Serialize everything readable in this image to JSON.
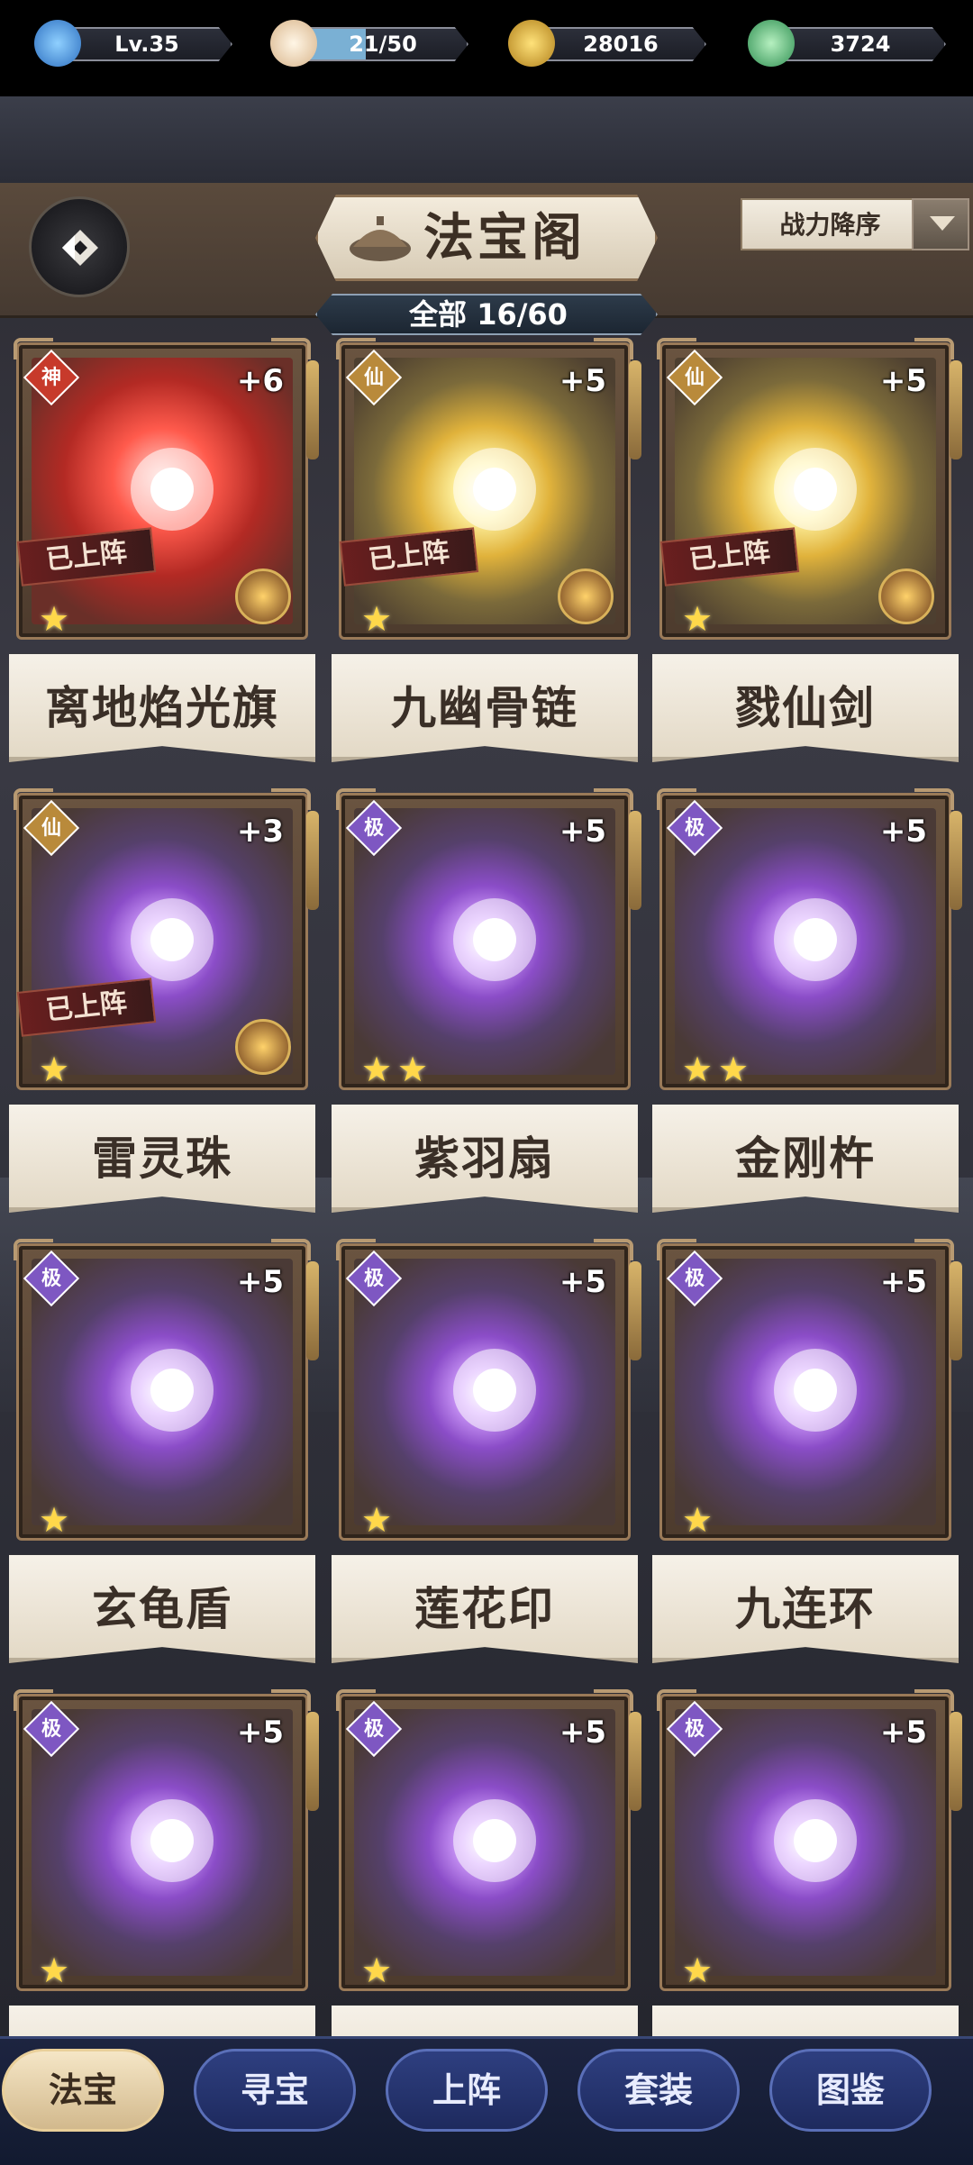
{
  "resources": {
    "level": "Lv.35",
    "stamina": "21/50",
    "stamina_fraction": 0.42,
    "coins": "28016",
    "jade": "3724"
  },
  "header": {
    "title": "法宝阁",
    "sort_label": "战力降序",
    "count_label": "全部 16/60"
  },
  "items": [
    {
      "name": "离地焰光旗",
      "grade": "神",
      "level": "+6",
      "stars": 1,
      "on_team": "已上阵",
      "glow": "red"
    },
    {
      "name": "九幽骨链",
      "grade": "仙",
      "level": "+5",
      "stars": 1,
      "on_team": "已上阵",
      "glow": "gold"
    },
    {
      "name": "戮仙剑",
      "grade": "仙",
      "level": "+5",
      "stars": 1,
      "on_team": "已上阵",
      "glow": "gold"
    },
    {
      "name": "雷灵珠",
      "grade": "仙",
      "level": "+3",
      "stars": 1,
      "on_team": "已上阵",
      "glow": "purple"
    },
    {
      "name": "紫羽扇",
      "grade": "极",
      "level": "+5",
      "stars": 2,
      "on_team": "",
      "glow": "purple"
    },
    {
      "name": "金刚杵",
      "grade": "极",
      "level": "+5",
      "stars": 2,
      "on_team": "",
      "glow": "purple"
    },
    {
      "name": "玄龟盾",
      "grade": "极",
      "level": "+5",
      "stars": 1,
      "on_team": "",
      "glow": "purple"
    },
    {
      "name": "莲花印",
      "grade": "极",
      "level": "+5",
      "stars": 1,
      "on_team": "",
      "glow": "purple"
    },
    {
      "name": "九连环",
      "grade": "极",
      "level": "+5",
      "stars": 1,
      "on_team": "",
      "glow": "purple"
    },
    {
      "name": "",
      "grade": "极",
      "level": "+5",
      "stars": 1,
      "on_team": "",
      "glow": "purple"
    },
    {
      "name": "",
      "grade": "极",
      "level": "+5",
      "stars": 1,
      "on_team": "",
      "glow": "purple"
    },
    {
      "name": "",
      "grade": "极",
      "level": "+5",
      "stars": 1,
      "on_team": "",
      "glow": "purple"
    }
  ],
  "nav": {
    "tabs": [
      "法宝",
      "寻宝",
      "上阵",
      "套装",
      "图鉴"
    ],
    "active": 0
  },
  "colors": {
    "accent_gold": "#d8b46a",
    "nav_blue": "#2e3f80",
    "onteam_red": "#6a1f1f"
  }
}
